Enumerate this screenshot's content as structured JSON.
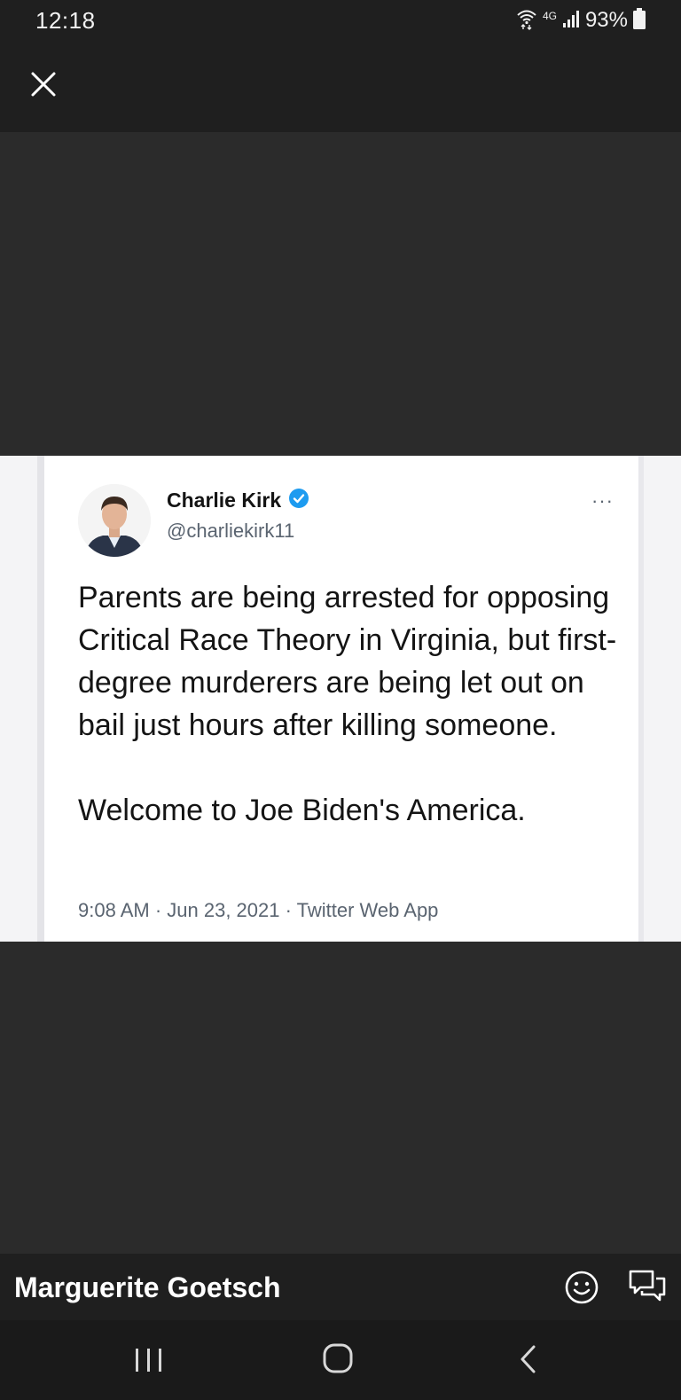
{
  "status_bar": {
    "time": "12:18",
    "network": "4G",
    "battery_percent": "93%"
  },
  "viewer": {
    "close_icon": "close-icon",
    "poster_name": "Marguerite Goetsch"
  },
  "tweet": {
    "author_name": "Charlie Kirk",
    "verified": true,
    "handle": "@charliekirk11",
    "more": "···",
    "text_paragraph_1": "Parents are being arrested for opposing Critical Race Theory in Virginia, but first-degree murderers are being let out on bail just hours after killing someone.",
    "text_paragraph_2": "Welcome to Joe Biden's America.",
    "meta": "9:08 AM · Jun 23, 2021 · Twitter Web App"
  },
  "actions": {
    "emoji_icon": "smiley-icon",
    "comment_icon": "comment-bubbles-icon"
  },
  "nav": {
    "recents_icon": "recents-icon",
    "home_icon": "home-icon",
    "back_icon": "back-icon"
  },
  "colors": {
    "background": "#2b2b2b",
    "bar": "#1f1f1f",
    "verified_blue": "#1d9bf0"
  }
}
